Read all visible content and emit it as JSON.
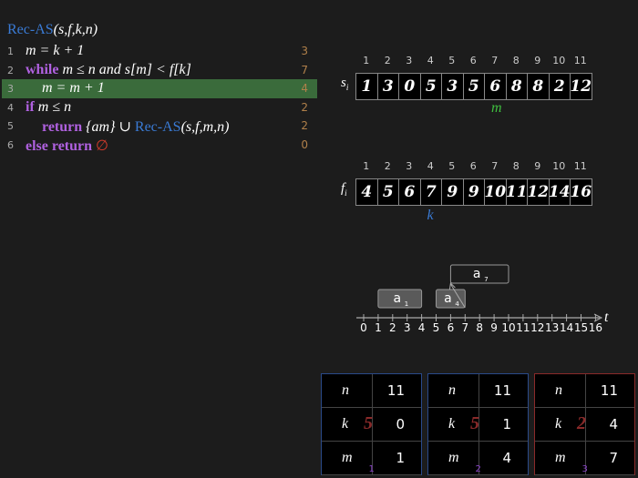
{
  "code": {
    "title_fn": "Rec-AS",
    "title_args": "(s,f,k,n)",
    "lines": [
      {
        "num": "1",
        "count": "3",
        "text": "m = k + 1"
      },
      {
        "num": "2",
        "count": "7",
        "kw": "while",
        "text": "m ≤ n and s[m] < f[k]"
      },
      {
        "num": "3",
        "count": "4",
        "text": "m = m + 1"
      },
      {
        "num": "4",
        "count": "2",
        "kw": "if",
        "text": "m ≤ n"
      },
      {
        "num": "5",
        "count": "2",
        "kw": "return",
        "text": "{am} ∪ ",
        "fn": "Rec-AS",
        "args": "(s,f,m,n)"
      },
      {
        "num": "6",
        "count": "0",
        "kw": "else return",
        "empty": "∅"
      }
    ],
    "highlight_line": 3,
    "highlight_color": "#3a6b3b"
  },
  "arrays": {
    "indices": [
      "1",
      "2",
      "3",
      "4",
      "5",
      "6",
      "7",
      "8",
      "9",
      "10",
      "11"
    ],
    "s_label": "s",
    "s_sub": "i",
    "s": [
      "1",
      "3",
      "0",
      "5",
      "3",
      "5",
      "6",
      "8",
      "8",
      "2",
      "12"
    ],
    "f_label": "f",
    "f_sub": "i",
    "f": [
      "4",
      "5",
      "6",
      "7",
      "9",
      "9",
      "10",
      "11",
      "12",
      "14",
      "16"
    ],
    "m_marker": "m",
    "m_index": 7,
    "k_marker": "k",
    "k_index": 4
  },
  "timeline": {
    "axis_label": "t",
    "ticks": [
      "0",
      "1",
      "2",
      "3",
      "4",
      "5",
      "6",
      "7",
      "8",
      "9",
      "10",
      "11",
      "12",
      "13",
      "14",
      "15",
      "16"
    ],
    "activities": [
      {
        "label": "a",
        "sub": "1",
        "start": 1,
        "end": 4,
        "level": 0
      },
      {
        "label": "a",
        "sub": "4",
        "start": 5,
        "end": 7,
        "level": 0
      },
      {
        "label": "a",
        "sub": "7",
        "start": 6,
        "end": 10,
        "level": 1
      }
    ]
  },
  "frames": [
    {
      "n": "11",
      "k": "0",
      "m": "1",
      "big": "5",
      "num": "1"
    },
    {
      "n": "11",
      "k": "1",
      "m": "4",
      "big": "5",
      "num": "2"
    },
    {
      "n": "11",
      "k": "4",
      "m": "7",
      "big": "2",
      "num": "3"
    }
  ],
  "frame_labels": {
    "n": "n",
    "k": "k",
    "m": "m"
  }
}
